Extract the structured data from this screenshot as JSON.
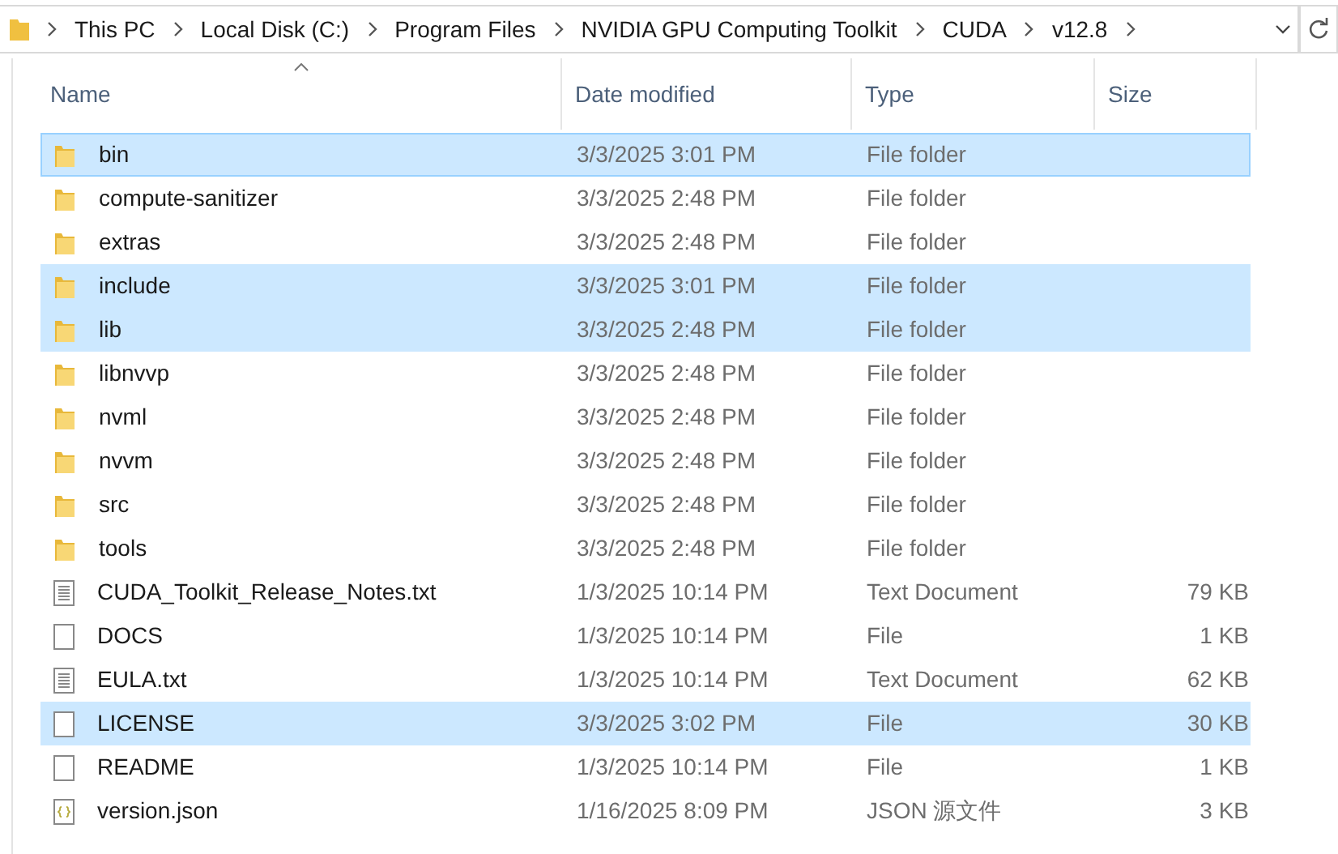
{
  "address_bar": {
    "path": [
      "This PC",
      "Local Disk (C:)",
      "Program Files",
      "NVIDIA GPU Computing Toolkit",
      "CUDA",
      "v12.8"
    ]
  },
  "table": {
    "columns": [
      {
        "label": "Name",
        "sorted": true
      },
      {
        "label": "Date modified",
        "sorted": false
      },
      {
        "label": "Type",
        "sorted": false
      },
      {
        "label": "Size",
        "sorted": false
      }
    ],
    "rows": [
      {
        "kind": "folder",
        "name": "bin",
        "date": "3/3/2025 3:01 PM",
        "type": "File folder",
        "selected": true
      },
      {
        "kind": "folder",
        "name": "compute-sanitizer",
        "date": "3/3/2025 2:48 PM",
        "type": "File folder",
        "selected": false
      },
      {
        "kind": "folder",
        "name": "extras",
        "date": "3/3/2025 2:48 PM",
        "type": "File folder",
        "selected": false
      },
      {
        "kind": "folder",
        "name": "include",
        "date": "3/3/2025 3:01 PM",
        "type": "File folder",
        "selected": true
      },
      {
        "kind": "folder",
        "name": "lib",
        "date": "3/3/2025 2:48 PM",
        "type": "File folder",
        "selected": true
      },
      {
        "kind": "folder",
        "name": "libnvvp",
        "date": "3/3/2025 2:48 PM",
        "type": "File folder",
        "selected": false
      },
      {
        "kind": "folder",
        "name": "nvml",
        "date": "3/3/2025 2:48 PM",
        "type": "File folder",
        "selected": false
      },
      {
        "kind": "folder",
        "name": "nvvm",
        "date": "3/3/2025 2:48 PM",
        "type": "File folder",
        "selected": false
      },
      {
        "kind": "folder",
        "name": "src",
        "date": "3/3/2025 2:48 PM",
        "type": "File folder",
        "selected": false
      },
      {
        "kind": "folder",
        "name": "tools",
        "date": "3/3/2025 2:48 PM",
        "type": "File folder",
        "selected": false
      },
      {
        "kind": "text",
        "name": "CUDA_Toolkit_Release_Notes.txt",
        "date": "1/3/2025 10:14 PM",
        "type": "Text Document",
        "size": "79 KB",
        "selected": false
      },
      {
        "kind": "file",
        "name": "DOCS",
        "date": "1/3/2025 10:14 PM",
        "type": "File",
        "size": "1 KB",
        "selected": false
      },
      {
        "kind": "text",
        "name": "EULA.txt",
        "date": "1/3/2025 10:14 PM",
        "type": "Text Document",
        "size": "62 KB",
        "selected": false
      },
      {
        "kind": "file",
        "name": "LICENSE",
        "date": "3/3/2025 3:02 PM",
        "type": "File",
        "size": "30 KB",
        "selected": true
      },
      {
        "kind": "file",
        "name": "README",
        "date": "1/3/2025 10:14 PM",
        "type": "File",
        "size": "1 KB",
        "selected": false
      },
      {
        "kind": "json",
        "name": "version.json",
        "date": "1/16/2025 8:09 PM",
        "type": "JSON 源文件",
        "size": "3 KB",
        "selected": false
      }
    ]
  }
}
